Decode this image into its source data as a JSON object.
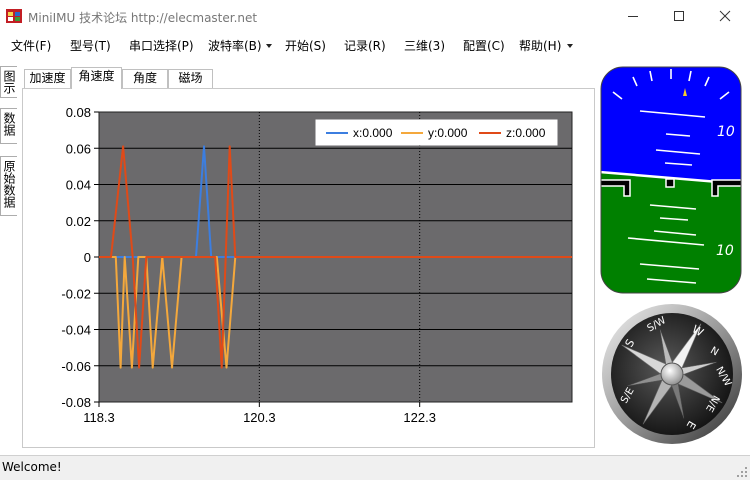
{
  "window": {
    "title": "MiniIMU 技术论坛 http://elecmaster.net"
  },
  "menu": {
    "items": [
      "文件(F)",
      "型号(T)",
      "串口选择(P)",
      "波特率(B)",
      "开始(S)",
      "记录(R)",
      "三维(3)",
      "配置(C)",
      "帮助(H)"
    ]
  },
  "side_tabs": [
    "图示",
    "数据",
    "原始数据"
  ],
  "tabs": [
    "加速度",
    "角速度",
    "角度",
    "磁场"
  ],
  "active_tab": "角速度",
  "chart_data": {
    "type": "line",
    "x_ticks": [
      "118.3",
      "120.3",
      "122.3"
    ],
    "y_ticks": [
      "0.08",
      "0.06",
      "0.04",
      "0.02",
      "0",
      "-0.02",
      "-0.04",
      "-0.06",
      "-0.08"
    ],
    "xlim": [
      118.3,
      124.2
    ],
    "ylim": [
      -0.08,
      0.08
    ],
    "plot_background": "#6b6a6c",
    "grid": true,
    "legend_position": "top-right",
    "series": [
      {
        "name": "x:0.000",
        "color": "#3c7ee0",
        "x": [
          118.3,
          118.42,
          118.57,
          118.67,
          118.78,
          118.95,
          119.17,
          119.31,
          119.44,
          119.51,
          119.61,
          119.7,
          119.9,
          121.5,
          124.2
        ],
        "y": [
          0,
          0,
          0,
          0,
          0,
          0,
          0,
          0,
          0,
          0,
          0.061,
          0,
          0,
          0,
          0
        ]
      },
      {
        "name": "y:0.000",
        "color": "#f4a83c",
        "x": [
          118.3,
          118.38,
          118.51,
          118.57,
          118.62,
          118.71,
          118.79,
          118.89,
          118.97,
          119.09,
          119.21,
          119.33,
          119.41,
          119.56,
          119.72,
          119.77,
          119.89,
          120.0,
          124.2
        ],
        "y": [
          0,
          0,
          0,
          -0.061,
          0,
          -0.061,
          0,
          0,
          -0.061,
          0,
          -0.061,
          0,
          0,
          0,
          0,
          0,
          -0.061,
          0,
          0
        ]
      },
      {
        "name": "z:0.000",
        "color": "#e04a18",
        "x": [
          118.3,
          118.45,
          118.6,
          118.72,
          118.8,
          118.89,
          118.98,
          119.1,
          119.25,
          119.39,
          119.55,
          119.75,
          119.83,
          119.93,
          120.0,
          120.3,
          124.2
        ],
        "y": [
          0,
          0,
          0.061,
          0,
          -0.061,
          0,
          0,
          0,
          0,
          0,
          0,
          0,
          -0.061,
          0.061,
          0,
          0,
          0
        ]
      }
    ]
  },
  "attitude_indicator": {
    "labels": [
      "10",
      "10"
    ],
    "sky_color": "#0000ff",
    "ground_color": "#008000"
  },
  "compass": {
    "labels": [
      "N",
      "N/E",
      "E",
      "S/E",
      "S",
      "S/W",
      "W",
      "N/W"
    ]
  },
  "status": {
    "text": "Welcome!"
  }
}
